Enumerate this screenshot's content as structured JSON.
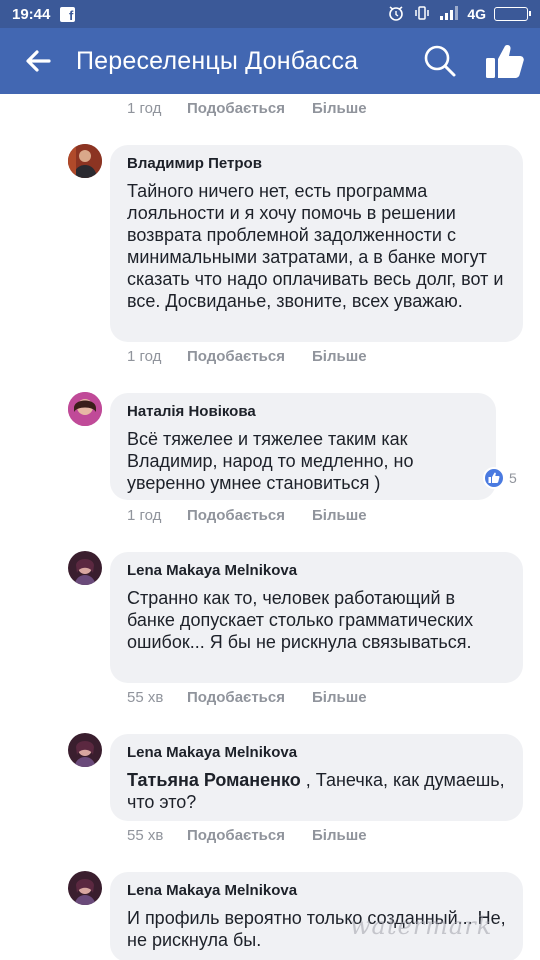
{
  "status_bar": {
    "time": "19:44",
    "network": "4G",
    "notification_icon": "facebook-f-icon"
  },
  "header": {
    "title": "Переселенцы Донбасса"
  },
  "labels": {
    "like": "Подобається",
    "more": "Більше"
  },
  "top_meta": {
    "time": "1 год"
  },
  "comments": [
    {
      "author": "Владимир Петров",
      "text": "Тайного ничего нет, есть программа лояльности и я хочу помочь в решении возврата проблемной задолженности с минимальными затратами, а в банке могут сказать что надо оплачивать весь долг, вот и все. Досвиданье, звоните, всех уважаю.",
      "time": "1 год"
    },
    {
      "author": "Наталія Новікова",
      "text": "Всё тяжелее и тяжелее таким как Владимир, народ то медленно, но уверенно умнее становиться )",
      "time": "1 год",
      "reaction_count": "5"
    },
    {
      "author": "Lena Makaya Melnikova",
      "text": "Странно как то, человек работающий в банке допускает столько грамматических ошибок... Я бы не рискнула связываться.",
      "time": "55 хв"
    },
    {
      "author": "Lena Makaya Melnikova",
      "mention": "Татьяна Романенко",
      "text": ", Танечка, как думаешь, что это?",
      "time": "55 хв"
    },
    {
      "author": "Lena Makaya Melnikova",
      "text": "И профиль вероятно только созданный... Не, не рискнула бы."
    }
  ],
  "watermark": "watermark",
  "colors": {
    "status_bar": "#3b5998",
    "header": "#4267b2",
    "bubble": "#f0f1f4",
    "meta": "#90949c",
    "reaction": "#4a7ae0"
  }
}
